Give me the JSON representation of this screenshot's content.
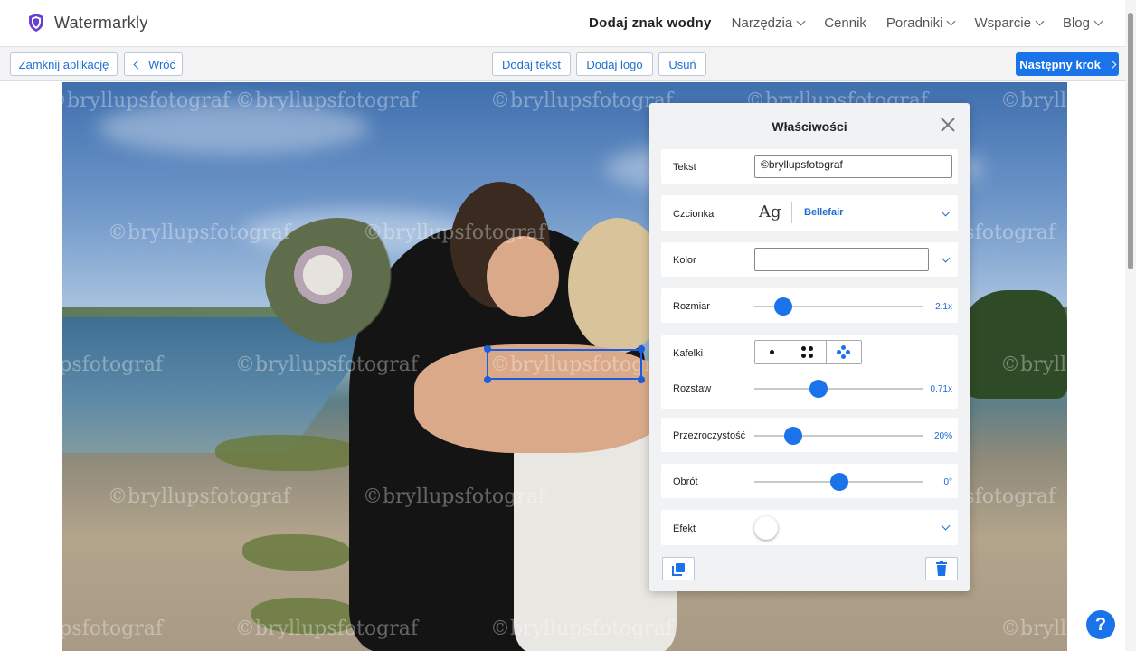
{
  "app": {
    "name": "Watermarkly",
    "accent": "#1a73e8"
  },
  "nav": {
    "items": [
      {
        "label": "Dodaj znak wodny",
        "dropdown": false,
        "active": true
      },
      {
        "label": "Narzędzia",
        "dropdown": true
      },
      {
        "label": "Cennik",
        "dropdown": false
      },
      {
        "label": "Poradniki",
        "dropdown": true
      },
      {
        "label": "Wsparcie",
        "dropdown": true
      },
      {
        "label": "Blog",
        "dropdown": true
      }
    ]
  },
  "toolbar": {
    "close_app": "Zamknij aplikację",
    "back": "Wróć",
    "add_text": "Dodaj tekst",
    "add_logo": "Dodaj logo",
    "delete": "Usuń",
    "next_step": "Następny krok"
  },
  "canvas": {
    "watermark_text": "©bryllupsfotograf"
  },
  "panel": {
    "title": "Właściwości",
    "text_label": "Tekst",
    "text_value": "©bryllupsfotograf",
    "font_label": "Czcionka",
    "font_preview": "Ag",
    "font_name": "Bellefair",
    "color_label": "Kolor",
    "color_value": "#ffffff",
    "size_label": "Rozmiar",
    "size_value": "2.1x",
    "size_fraction": 0.17,
    "tiles_label": "Kafelki",
    "tiles_options": [
      "single",
      "grid",
      "diagonal"
    ],
    "tiles_selected": "diagonal",
    "spacing_label": "Rozstaw",
    "spacing_value": "0.71x",
    "spacing_fraction": 0.38,
    "opacity_label": "Przezroczystość",
    "opacity_value": "20%",
    "opacity_fraction": 0.23,
    "rotation_label": "Obrót",
    "rotation_value": "0°",
    "rotation_fraction": 0.5,
    "effect_label": "Efekt",
    "effect_enabled": false
  },
  "help": {
    "label": "?"
  }
}
